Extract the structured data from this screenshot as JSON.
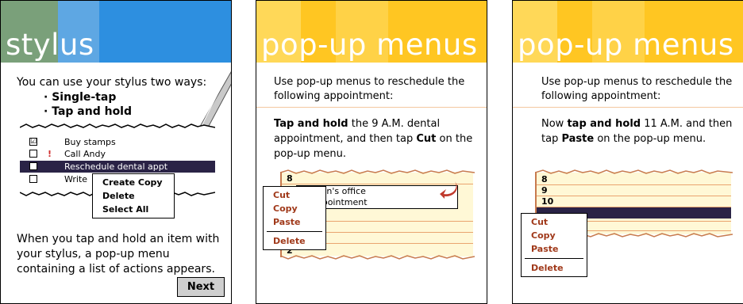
{
  "panel1": {
    "title": "stylus",
    "intro": "You can use your stylus two ways:",
    "bullet1": "Single-tap",
    "bullet2": "Tap and hold",
    "list": [
      {
        "label": "Buy stamps",
        "checked": "☑"
      },
      {
        "label": "Call Andy",
        "priority": "!"
      },
      {
        "label": "Reschedule dental appt"
      },
      {
        "label": "Write"
      }
    ],
    "popup": [
      "Create Copy",
      "Delete",
      "Select All"
    ],
    "bottom": "When you tap and hold an item with your stylus, a pop-up menu containing a list of actions appears.",
    "next_label": "Next"
  },
  "panel2": {
    "title": "pop-up menus",
    "intro": "Use pop-up menus to reschedule the following appointment:",
    "instr_bold1": "Tap and hold",
    "instr_mid": " the 9 A.M. dental appointment, and then tap ",
    "instr_bold2": "Cut",
    "instr_end": " on the pop-up menu.",
    "cal_top": "8",
    "cal_bottom": "2",
    "appt_line1": "nson's office",
    "appt_line2": "appointment",
    "popup": [
      "Cut",
      "Copy",
      "Paste",
      "Delete"
    ]
  },
  "panel3": {
    "title": "pop-up menus",
    "intro": "Use pop-up menus to reschedule the following appointment:",
    "instr_start": "Now ",
    "instr_bold1": "tap and hold",
    "instr_mid": " 11 A.M. and then tap ",
    "instr_bold2": "Paste",
    "instr_end": " on the pop-up menu.",
    "hours": [
      "8",
      "9",
      "10"
    ],
    "popup": [
      "Cut",
      "Copy",
      "Paste",
      "Delete"
    ]
  },
  "colors": {
    "blue_banner": "#2d8fe0",
    "yellow_banner": "#ffc622",
    "menu_red": "#a0391a",
    "selection": "#2a2346"
  }
}
